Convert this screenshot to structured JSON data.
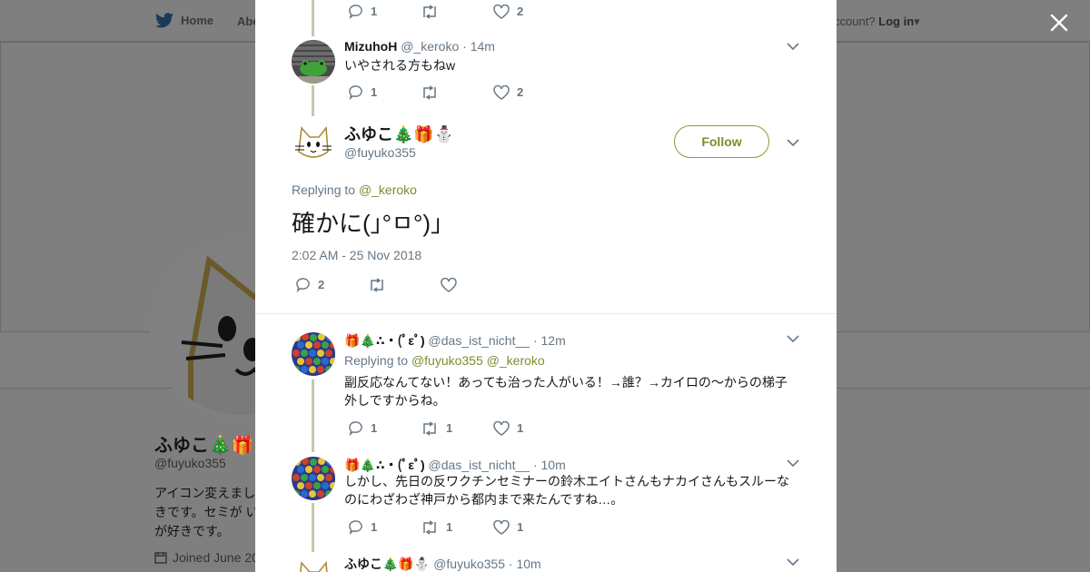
{
  "background": {
    "nav": {
      "home": "Home",
      "about": "Abo",
      "account_prefix": "ccount?",
      "login": "Log in"
    },
    "profile": {
      "name": "ふゆこ🎄🎁",
      "handle": "@fuyuko355",
      "bio": "アイコン変えまし 好きです。セミが い人が好きです。",
      "joined": "Joined June 20"
    }
  },
  "tweets": {
    "prev": {
      "reply_count": "1",
      "like_count": "2"
    },
    "mizuho": {
      "name": "MizuhoH",
      "handle": "@_keroko",
      "time": "· 14m",
      "text": "いやされる方もねw",
      "reply_count": "1",
      "like_count": "2"
    },
    "main": {
      "name": "ふゆこ🎄🎁⛄",
      "handle": "@fuyuko355",
      "follow_label": "Follow",
      "replying_prefix": "Replying to",
      "replying_to": "@_keroko",
      "text": "確かに(｣°ㅁ°)｣",
      "timestamp": "2:02 AM - 25 Nov 2018",
      "reply_count": "2"
    },
    "das1": {
      "name": "🎁🎄∴・(ﾟεﾟ)",
      "handle": "@das_ist_nicht__",
      "time": "· 12m",
      "replying_prefix": "Replying to",
      "replying_to_1": "@fuyuko355",
      "replying_to_2": "@_keroko",
      "text": "副反応なんてない！あっても治った人がいる！→誰？→カイロの～からの梯子外しですからね。",
      "reply_count": "1",
      "retweet_count": "1",
      "like_count": "1"
    },
    "das2": {
      "name": "🎁🎄∴・(ﾟεﾟ)",
      "handle": "@das_ist_nicht__",
      "time": "· 10m",
      "text": "しかし、先日の反ワクチンセミナーの鈴木エイトさんもナカイさんもスルーなのにわざわざ神戸から都内まで来たんですね…。",
      "reply_count": "1",
      "retweet_count": "1",
      "like_count": "1"
    },
    "fuyuko2": {
      "name": "ふゆこ🎄🎁⛄",
      "handle": "@fuyuko355",
      "time": "· 10m"
    }
  },
  "colors": {
    "accent": "#7d8c2e",
    "thread_line": "#c5c9a8",
    "overlay": "#7f7f7f"
  }
}
